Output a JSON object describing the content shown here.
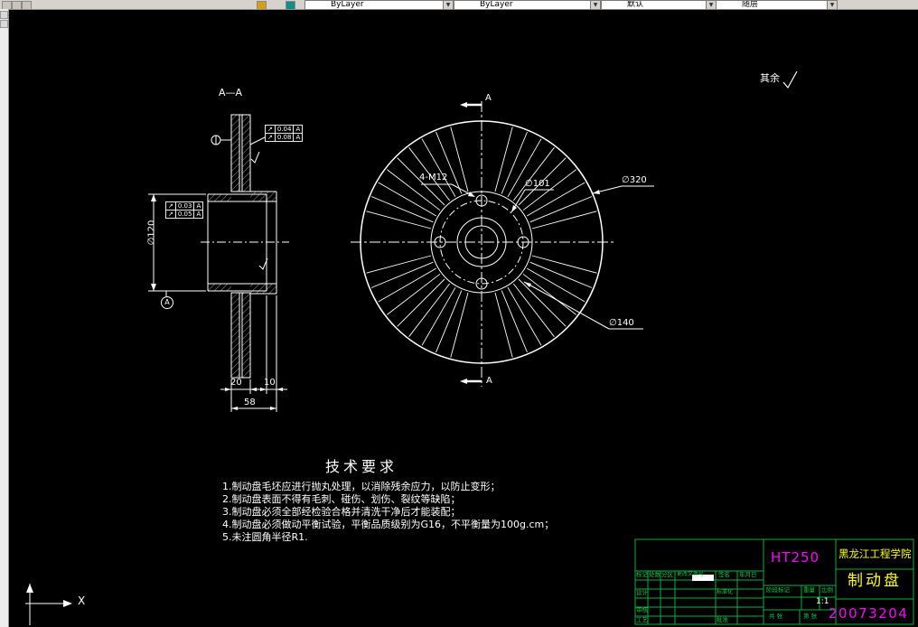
{
  "toolbar": {
    "combos": [
      {
        "value": "ByLayer"
      },
      {
        "value": "ByLayer"
      },
      {
        "value": "默认"
      },
      {
        "value": "随层"
      }
    ]
  },
  "drawing": {
    "section_label": "A—A",
    "section_mark": "A",
    "surface_note": "其余",
    "ucs_x": "X",
    "dims": {
      "flange_dia": "∅120",
      "ring_thickness": "20",
      "wall": "10",
      "overall": "58",
      "bolt_holes": "4-M12",
      "bore": "∅101",
      "outer_dia": "∅320",
      "vane_dia": "∅140"
    },
    "gdt": {
      "left_rows": [
        {
          "sym": "↗",
          "value": "0.03",
          "datum": "A"
        },
        {
          "sym": "↗",
          "value": "0.05",
          "datum": "A"
        }
      ],
      "top_rows": [
        {
          "sym": "↗",
          "value": "0.04",
          "datum": "A"
        },
        {
          "sym": "↗",
          "value": "0.08",
          "datum": "A"
        }
      ],
      "datum_label": "A"
    }
  },
  "tech_requirements": {
    "title": "技术要求",
    "items": [
      "1.制动盘毛坯应进行抛丸处理，以消除残余应力，以防止变形；",
      "2.制动盘表面不得有毛刺、碰伤、划伤、裂纹等缺陷；",
      "3.制动盘必须全部经检验合格并清洗干净后才能装配；",
      "4.制动盘必须做动平衡试验，平衡品质级别为G16，不平衡量为100g.cm；",
      "5.未注圆角半径R1."
    ]
  },
  "title_block": {
    "material": "HT250",
    "school": "黑龙江工程学院",
    "part": "制动盘",
    "number": "20073204",
    "scale_value": "1:1",
    "labels": {
      "mark": "标记",
      "count": "处数",
      "zone": "分区",
      "change_file": "更改文件号",
      "sign": "签名",
      "date": "年月日",
      "design": "设计",
      "standardize": "标准化",
      "check": "审核",
      "craft": "工艺",
      "approve": "批准",
      "stage": "阶段标记",
      "weight": "重量",
      "scale": "比例",
      "sheets_total": "共 张",
      "sheet_no": "第 张"
    }
  }
}
